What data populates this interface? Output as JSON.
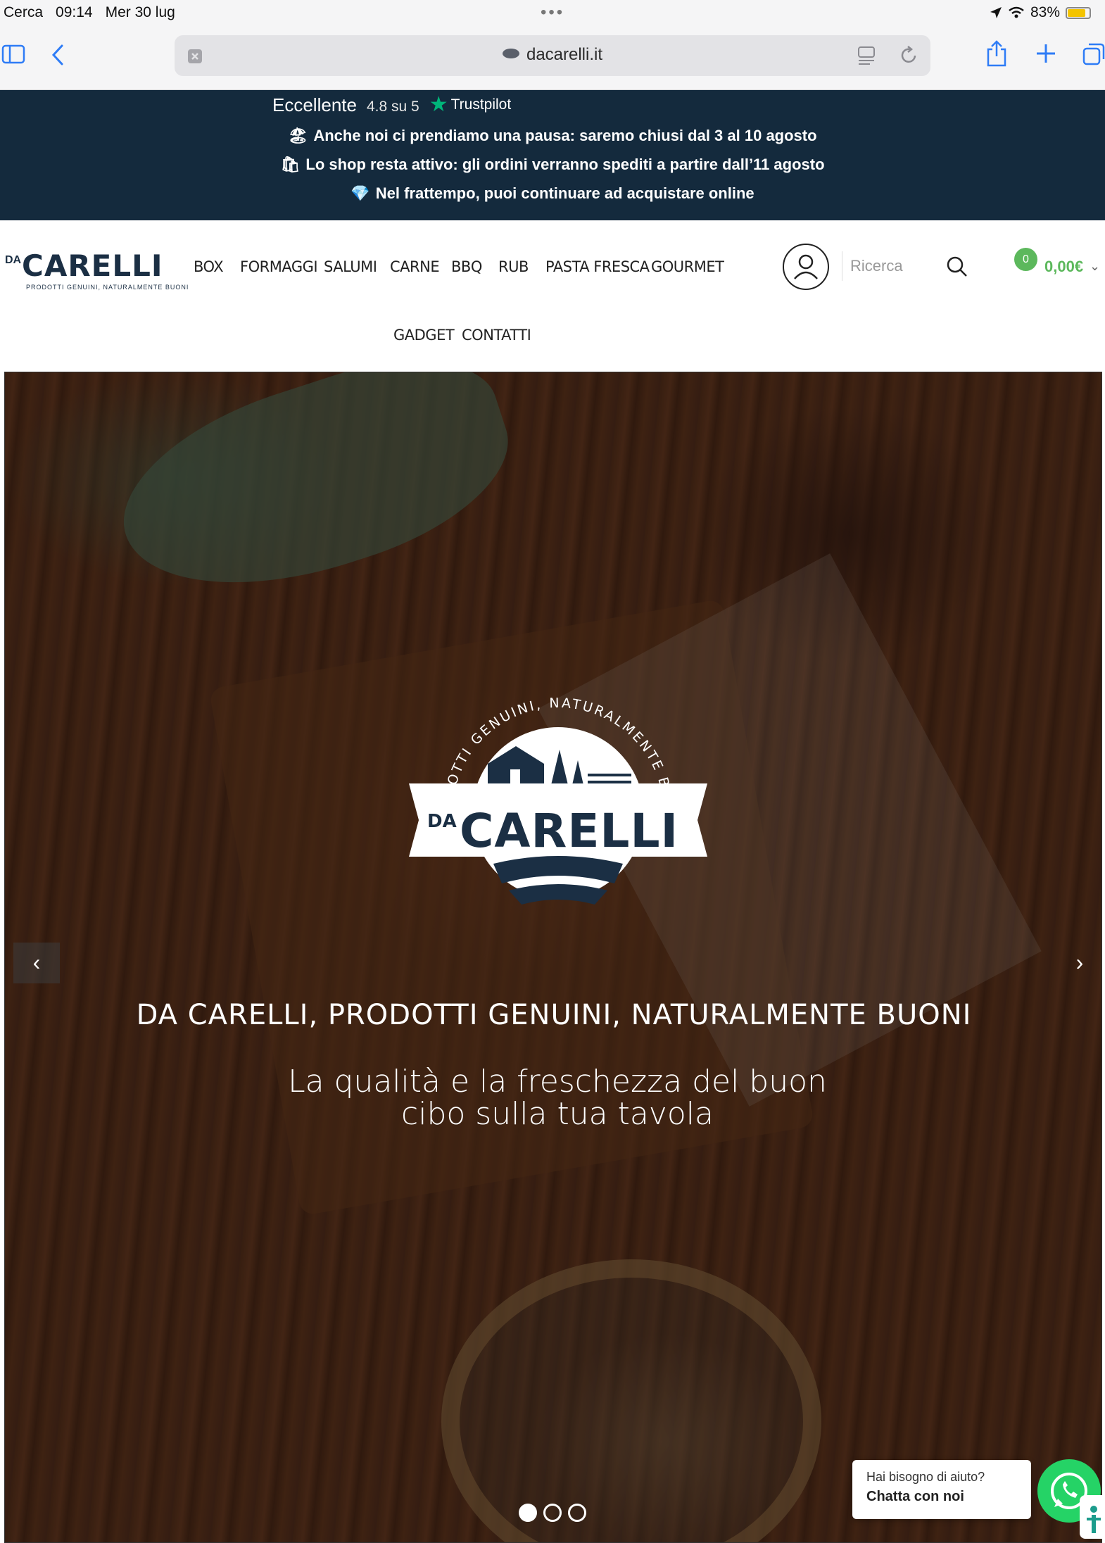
{
  "status_bar": {
    "back_app": "Cerca",
    "time": "09:14",
    "date": "Mer 30 lug",
    "dots": "•••",
    "battery": "83%",
    "battery_level": 0.83,
    "battery_color": "#f4c400"
  },
  "browser": {
    "url": "dacarelli.it",
    "icons": [
      "sidebar-icon",
      "back-icon",
      "close-tab-icon",
      "reader-icon",
      "reload-icon",
      "share-icon",
      "new-tab-icon",
      "tabs-icon"
    ]
  },
  "announcement": {
    "trustpilot": {
      "rating_word": "Eccellente",
      "score": "4.8 su 5",
      "brand": "Trustpilot"
    },
    "notices": [
      {
        "emoji": "🏖",
        "text": "Anche noi ci prendiamo una pausa: saremo chiusi dal 3 al 10 agosto"
      },
      {
        "emoji": "🛍",
        "text": "Lo shop resta attivo: gli ordini verranno spediti a partire dall’11 agosto"
      },
      {
        "emoji": "💎",
        "text": "Nel frattempo, puoi continuare ad acquistare online"
      }
    ],
    "background": "#142a3d"
  },
  "header": {
    "logo": {
      "da": "DA",
      "brand": "CARELLI",
      "tagline": "PRODOTTI GENUINI, NATURALMENTE BUONI"
    },
    "nav": [
      "BOX",
      "FORMAGGI",
      "SALUMI",
      "CARNE",
      "BBQ",
      "RUB",
      "PASTA FRESCA",
      "GOURMET",
      "GADGET",
      "CONTATTI"
    ],
    "search_placeholder": "Ricerca",
    "cart": {
      "count": "0",
      "total": "0,00€"
    },
    "accent": "#5cb85c"
  },
  "hero": {
    "emblem": {
      "arc_text": "PRODOTTI GENUINI, NATURALMENTE BUONI",
      "da": "DA",
      "brand": "CARELLI"
    },
    "title": "DA CARELLI, PRODOTTI GENUINI, NATURALMENTE BUONI",
    "subtitle": "La qualità e la freschezza del buon cibo sulla tua tavola",
    "slides": 3,
    "active_slide": 1,
    "prev_label": "‹",
    "next_label": "›"
  },
  "help": {
    "question": "Hai bisogno di aiuto?",
    "action": "Chatta con noi",
    "whatsapp_color": "#25d366"
  }
}
